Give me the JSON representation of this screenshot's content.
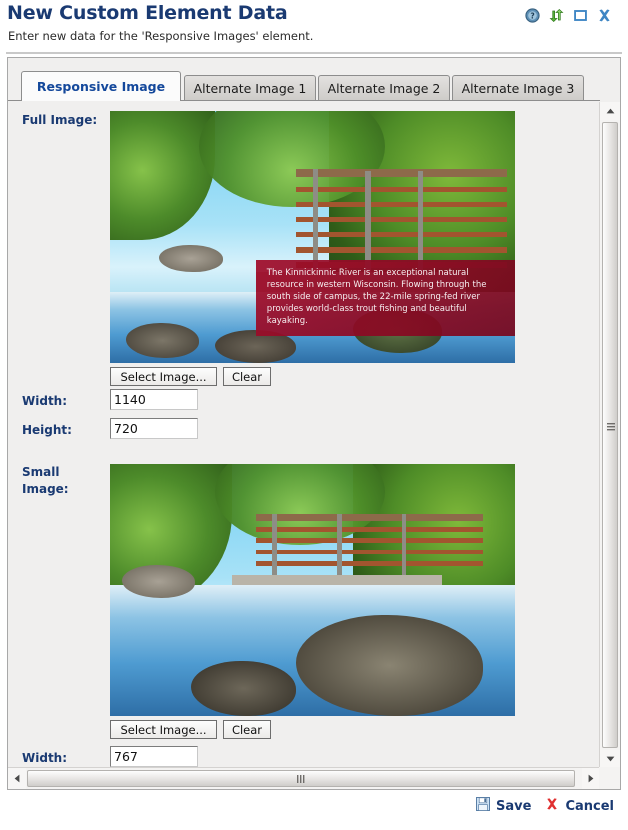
{
  "header": {
    "title": "New Custom Element Data",
    "subtitle": "Enter new data for the 'Responsive Images' element.",
    "icons": [
      {
        "name": "help-icon",
        "glyph": "?"
      },
      {
        "name": "refresh-icon",
        "glyph": "⇄"
      },
      {
        "name": "maximize-icon",
        "glyph": "□"
      },
      {
        "name": "close-icon",
        "glyph": "✕"
      }
    ]
  },
  "tabs": [
    {
      "label": "Responsive Image",
      "active": true
    },
    {
      "label": "Alternate Image 1",
      "active": false
    },
    {
      "label": "Alternate Image 2",
      "active": false
    },
    {
      "label": "Alternate Image 3",
      "active": false
    }
  ],
  "form": {
    "full_image": {
      "label": "Full Image:",
      "caption": "The Kinnickinnic River is an exceptional natural resource in western Wisconsin. Flowing through the south side of campus, the 22-mile spring-fed river provides world-class trout fishing and beautiful kayaking.",
      "select_button": "Select Image...",
      "clear_button": "Clear",
      "width_label": "Width:",
      "width_value": "1140",
      "height_label": "Height:",
      "height_value": "720"
    },
    "small_image": {
      "label_line1": "Small",
      "label_line2": "Image:",
      "select_button": "Select Image...",
      "clear_button": "Clear",
      "width_label": "Width:",
      "width_value": "767"
    }
  },
  "scrollbars": {
    "vertical": {
      "up_arrow": "▲",
      "down_arrow": "▼"
    },
    "horizontal": {
      "left_arrow": "◀",
      "right_arrow": "▶"
    }
  },
  "footer": {
    "save_label": "Save",
    "cancel_label": "Cancel"
  },
  "colors": {
    "title_blue": "#1a3a72",
    "active_tab_blue": "#14489b",
    "caption_red": "#a00c2a",
    "cancel_red": "#e03030",
    "panel_bg": "#f0efee"
  }
}
